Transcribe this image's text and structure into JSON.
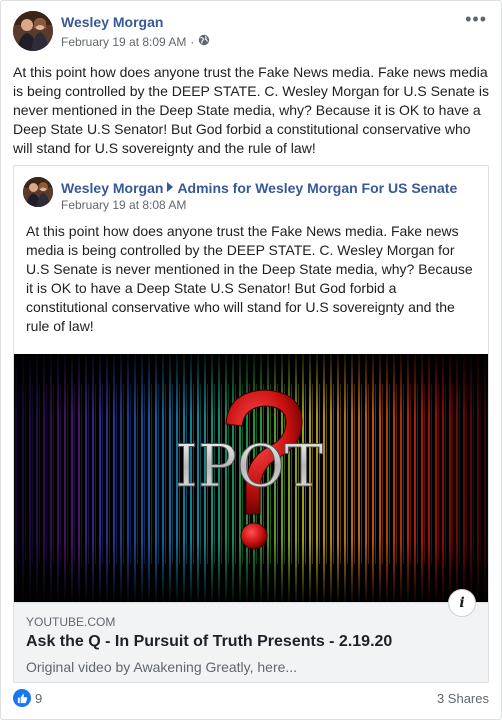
{
  "post": {
    "author": "Wesley Morgan",
    "timestamp": "February 19 at 8:09 AM",
    "separator": "·",
    "audience_icon": "globe-icon",
    "text": "At this point how does anyone trust the Fake News media. Fake news media is being controlled by the DEEP STATE. C. Wesley Morgan for U.S Senate is never mentioned in the Deep State media, why? Because it is OK to have a Deep State U.S Senator! But God forbid a constitutional conservative who will stand for U.S sovereignty and the rule of law!",
    "more_icon": "more-options-icon"
  },
  "shared": {
    "author": "Wesley Morgan",
    "group": "Admins for Wesley Morgan For US Senate",
    "timestamp": "February 19 at 8:08 AM",
    "text": "At this point how does anyone trust the Fake News media. Fake news media is being controlled by the DEEP STATE. C. Wesley Morgan for U.S Senate is never mentioned in the Deep State media, why? Because it is OK to have a Deep State U.S Senator! But God forbid a constitutional conservative who will stand for U.S sovereignty and the rule of law!"
  },
  "video": {
    "thumbnail_text": "IPOT"
  },
  "link": {
    "domain": "YOUTUBE.COM",
    "title": "Ask the Q - In Pursuit of Truth Presents - 2.19.20",
    "description": "Original video by Awakening Greatly, here...",
    "info_label": "i"
  },
  "footer": {
    "like_count": "9",
    "shares": "3 Shares"
  },
  "colors": {
    "link_blue": "#385898",
    "like_blue": "#1877f2",
    "meta_gray": "#616770"
  }
}
